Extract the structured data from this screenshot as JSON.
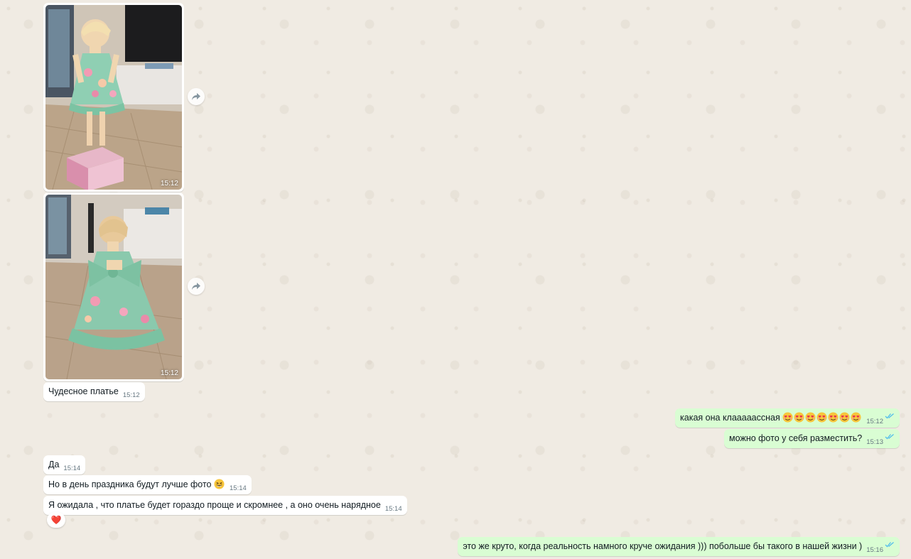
{
  "chat": {
    "photo1": {
      "time": "15:12",
      "alt": "photo-dress-front"
    },
    "photo2": {
      "time": "15:12",
      "alt": "photo-dress-back"
    },
    "messages": [
      {
        "id": "m1",
        "direction": "in",
        "text": "Чудесное платье",
        "time": "15:12"
      },
      {
        "id": "m2",
        "direction": "out",
        "text": "какая она клааааассная",
        "emoji_count": 7,
        "emoji_name": "smiling-face-with-hearts-icon",
        "time": "15:12",
        "status": "read"
      },
      {
        "id": "m3",
        "direction": "out",
        "text": "можно фото у себя разместить?",
        "time": "15:13",
        "status": "read"
      },
      {
        "id": "m4",
        "direction": "in",
        "text": "Да",
        "time": "15:14"
      },
      {
        "id": "m5",
        "direction": "in",
        "text": "Но в день праздника будут лучше фото",
        "emoji_name": "grinning-squinting-face-icon",
        "time": "15:14"
      },
      {
        "id": "m6",
        "direction": "in",
        "text": "Я ожидала , что платье будет гораздо проще и скромнее , а оно очень нарядное",
        "time": "15:14",
        "reaction": "❤️"
      },
      {
        "id": "m7",
        "direction": "out",
        "text": "это же круто, когда реальность намного круче ожидания ))) побольше бы такого в нашей жизни )",
        "time": "15:16",
        "status": "read"
      }
    ]
  },
  "colors": {
    "incoming_bg": "#ffffff",
    "outgoing_bg": "#d9fdd3",
    "wallpaper": "#efeae2",
    "read_tick": "#53bdeb",
    "meta_text": "#667781"
  }
}
